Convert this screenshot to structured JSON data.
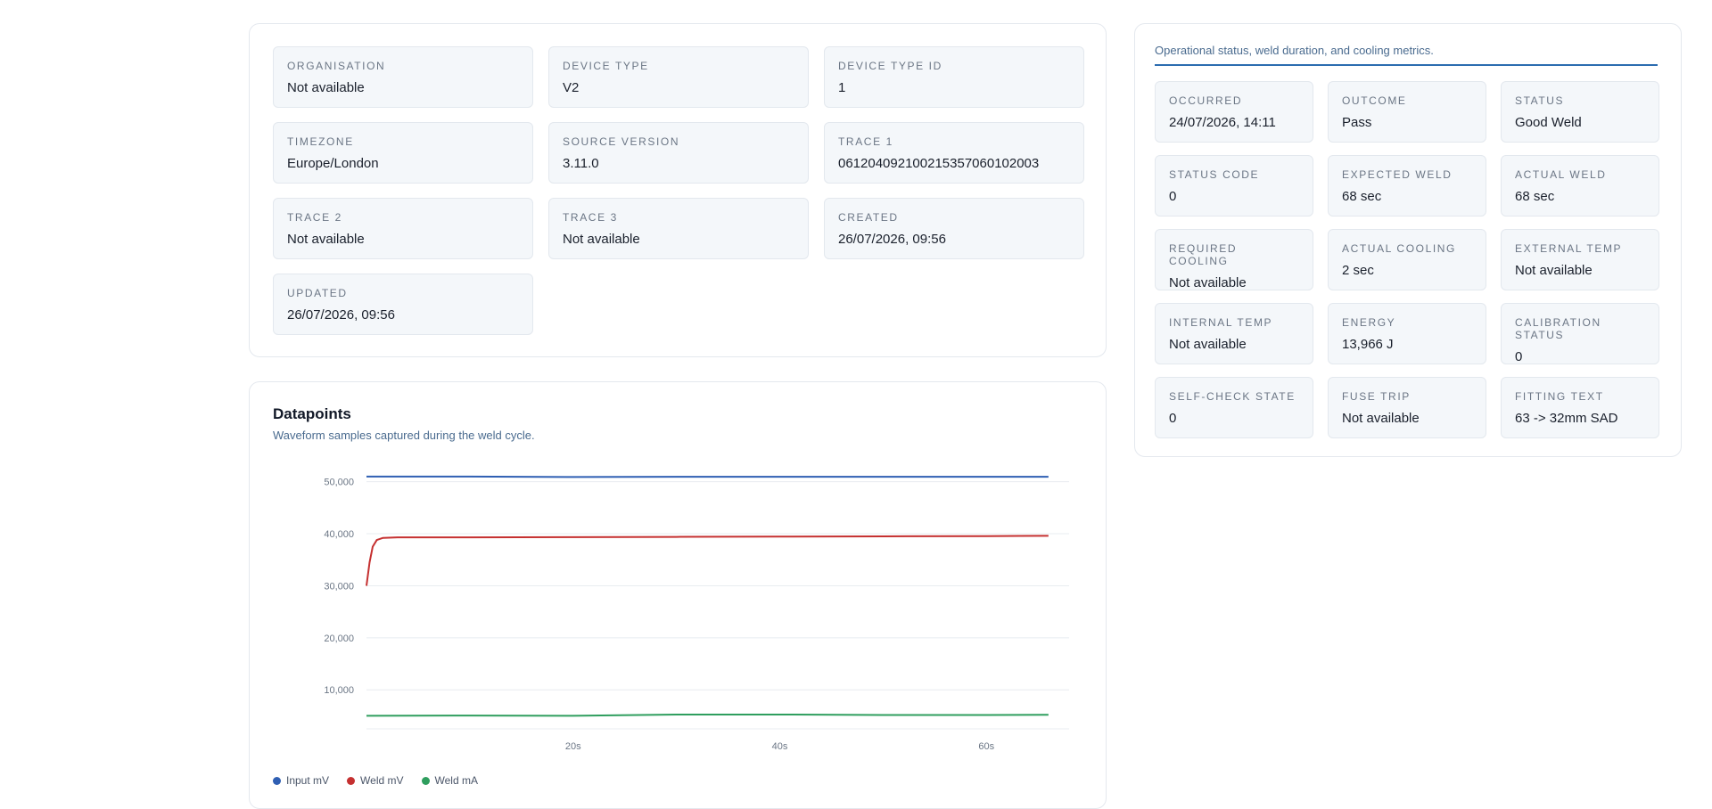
{
  "device_details": {
    "fields": [
      {
        "label": "ORGANISATION",
        "value": "Not available"
      },
      {
        "label": "DEVICE TYPE",
        "value": "V2"
      },
      {
        "label": "DEVICE TYPE ID",
        "value": "1"
      },
      {
        "label": "TIMEZONE",
        "value": "Europe/London"
      },
      {
        "label": "SOURCE VERSION",
        "value": "3.11.0"
      },
      {
        "label": "TRACE 1",
        "value": "061204092100215357060102003"
      },
      {
        "label": "TRACE 2",
        "value": "Not available"
      },
      {
        "label": "TRACE 3",
        "value": "Not available"
      },
      {
        "label": "CREATED",
        "value": "26/07/2026, 09:56"
      },
      {
        "label": "UPDATED",
        "value": "26/07/2026, 09:56"
      }
    ]
  },
  "status_panel": {
    "subtitle": "Operational status, weld duration, and cooling metrics.",
    "fields": [
      {
        "label": "OCCURRED",
        "value": "24/07/2026, 14:11"
      },
      {
        "label": "OUTCOME",
        "value": "Pass"
      },
      {
        "label": "STATUS",
        "value": "Good Weld"
      },
      {
        "label": "STATUS CODE",
        "value": "0"
      },
      {
        "label": "EXPECTED WELD",
        "value": "68 sec"
      },
      {
        "label": "ACTUAL WELD",
        "value": "68 sec"
      },
      {
        "label": "REQUIRED COOLING",
        "value": "Not available"
      },
      {
        "label": "ACTUAL COOLING",
        "value": "2 sec"
      },
      {
        "label": "EXTERNAL TEMP",
        "value": "Not available"
      },
      {
        "label": "INTERNAL TEMP",
        "value": "Not available"
      },
      {
        "label": "ENERGY",
        "value": "13,966 J"
      },
      {
        "label": "CALIBRATION STATUS",
        "value": "0"
      },
      {
        "label": "SELF-CHECK STATE",
        "value": "0"
      },
      {
        "label": "FUSE TRIP",
        "value": "Not available"
      },
      {
        "label": "FITTING TEXT",
        "value": "63 -> 32mm SAD"
      }
    ]
  },
  "datapoints": {
    "title": "Datapoints",
    "subtitle": "Waveform samples captured during the weld cycle."
  },
  "chart_data": {
    "type": "line",
    "title": "",
    "xlabel": "",
    "ylabel": "",
    "xlim": [
      0,
      68
    ],
    "ylim": [
      2500,
      52000
    ],
    "y_ticks": [
      10000,
      20000,
      30000,
      40000,
      50000
    ],
    "y_tick_labels": [
      "10,000",
      "20,000",
      "30,000",
      "40,000",
      "50,000"
    ],
    "x_ticks": [
      20,
      40,
      60
    ],
    "x_tick_labels": [
      "20s",
      "40s",
      "60s"
    ],
    "grid": true,
    "legend_position": "bottom-left",
    "series": [
      {
        "name": "Input mV",
        "color": "#2f5fb3",
        "points": [
          [
            0,
            51000
          ],
          [
            10,
            51000
          ],
          [
            20,
            50900
          ],
          [
            30,
            50950
          ],
          [
            40,
            50950
          ],
          [
            50,
            50950
          ],
          [
            60,
            50950
          ],
          [
            66,
            50950
          ]
        ]
      },
      {
        "name": "Weld mV",
        "color": "#c53030",
        "points": [
          [
            0,
            30000
          ],
          [
            0.3,
            34500
          ],
          [
            0.6,
            37500
          ],
          [
            1,
            38800
          ],
          [
            1.6,
            39200
          ],
          [
            3,
            39300
          ],
          [
            10,
            39300
          ],
          [
            20,
            39350
          ],
          [
            30,
            39400
          ],
          [
            40,
            39450
          ],
          [
            50,
            39500
          ],
          [
            60,
            39550
          ],
          [
            66,
            39600
          ]
        ]
      },
      {
        "name": "Weld mA",
        "color": "#2f9e5e",
        "points": [
          [
            0,
            5000
          ],
          [
            10,
            5050
          ],
          [
            20,
            5000
          ],
          [
            30,
            5250
          ],
          [
            40,
            5250
          ],
          [
            50,
            5150
          ],
          [
            60,
            5150
          ],
          [
            66,
            5200
          ]
        ]
      }
    ]
  }
}
